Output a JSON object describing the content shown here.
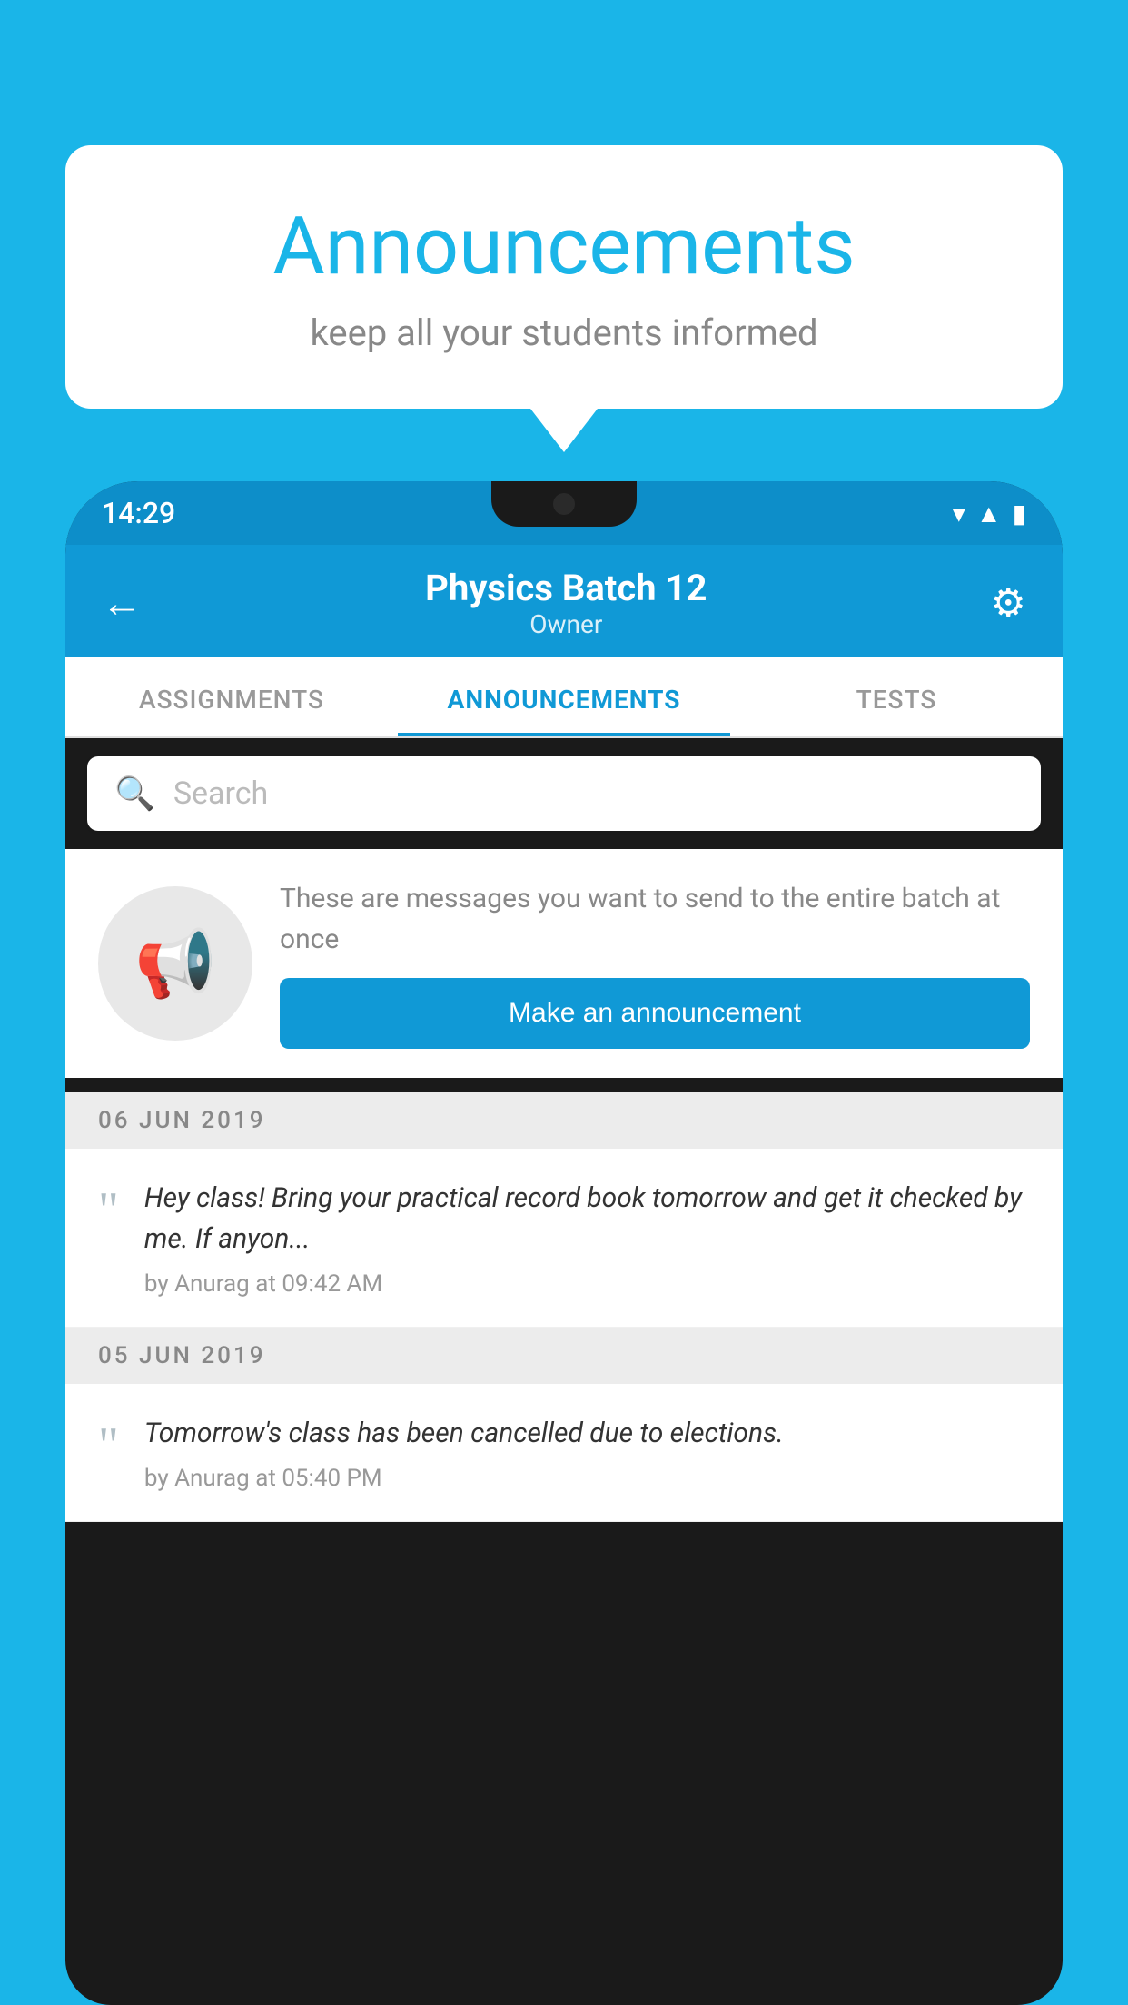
{
  "background_color": "#1ab5e8",
  "speech_bubble": {
    "title": "Announcements",
    "subtitle": "keep all your students informed"
  },
  "phone": {
    "status_bar": {
      "time": "14:29",
      "icons": [
        "▼",
        "▲",
        "🔋"
      ]
    },
    "header": {
      "title": "Physics Batch 12",
      "subtitle": "Owner",
      "back_label": "←",
      "gear_label": "⚙"
    },
    "tabs": [
      {
        "label": "ASSIGNMENTS",
        "active": false
      },
      {
        "label": "ANNOUNCEMENTS",
        "active": true
      },
      {
        "label": "TESTS",
        "active": false
      },
      {
        "label": "...",
        "active": false
      }
    ],
    "search": {
      "placeholder": "Search"
    },
    "promo": {
      "description": "These are messages you want to send to the entire batch at once",
      "button_label": "Make an announcement"
    },
    "announcements": [
      {
        "date": "06  JUN  2019",
        "text": "Hey class! Bring your practical record book tomorrow and get it checked by me. If anyon...",
        "meta": "by Anurag at 09:42 AM"
      },
      {
        "date": "05  JUN  2019",
        "text": "Tomorrow's class has been cancelled due to elections.",
        "meta": "by Anurag at 05:40 PM"
      }
    ]
  }
}
